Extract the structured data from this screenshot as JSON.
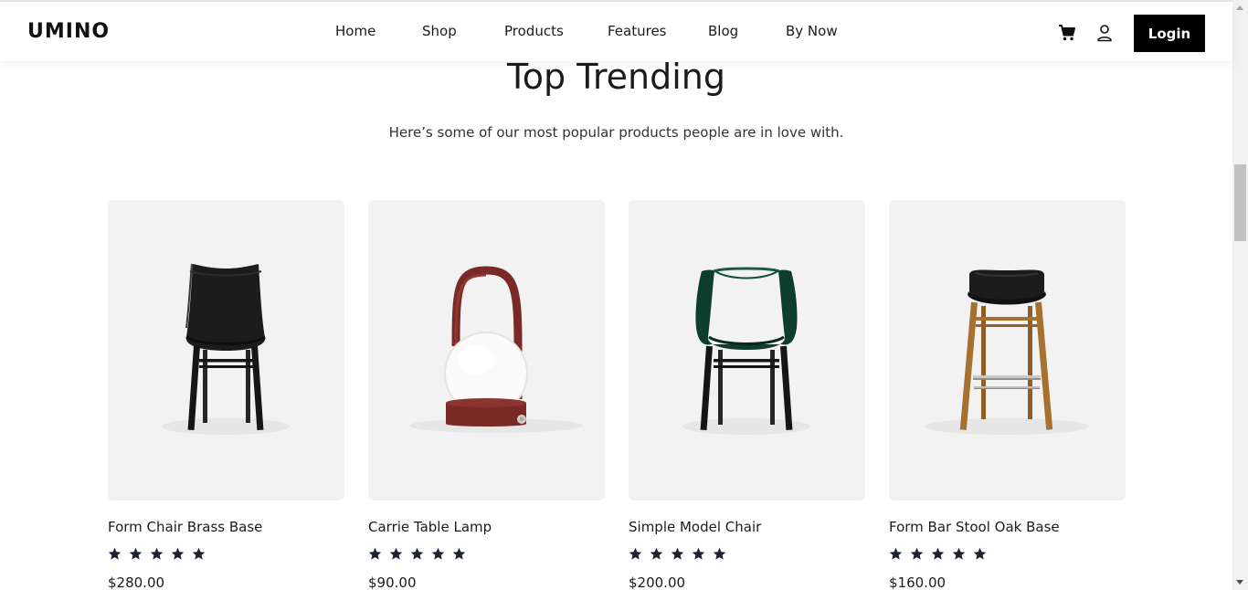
{
  "header": {
    "logo": "UMINO",
    "nav": [
      "Home",
      "Shop",
      "Products",
      "Features",
      "Blog",
      "By Now"
    ],
    "cart_icon": "cart-icon",
    "user_icon": "user-icon",
    "login_label": "Login"
  },
  "section": {
    "title": "Top Trending",
    "subtitle": "Here’s some of our most popular products people are in love with."
  },
  "products": [
    {
      "name": "Form Chair Brass Base",
      "rating": 5,
      "price": "$280.00",
      "image": "black-chair"
    },
    {
      "name": "Carrie Table Lamp",
      "rating": 5,
      "price": "$90.00",
      "image": "table-lamp"
    },
    {
      "name": "Simple Model Chair",
      "rating": 5,
      "price": "$200.00",
      "image": "green-armchair"
    },
    {
      "name": "Form Bar Stool Oak Base",
      "rating": 5,
      "price": "$160.00",
      "image": "bar-stool"
    }
  ],
  "colors": {
    "accent": "#000000",
    "card_bg": "#f2f2f2",
    "star": "#1b2233"
  }
}
